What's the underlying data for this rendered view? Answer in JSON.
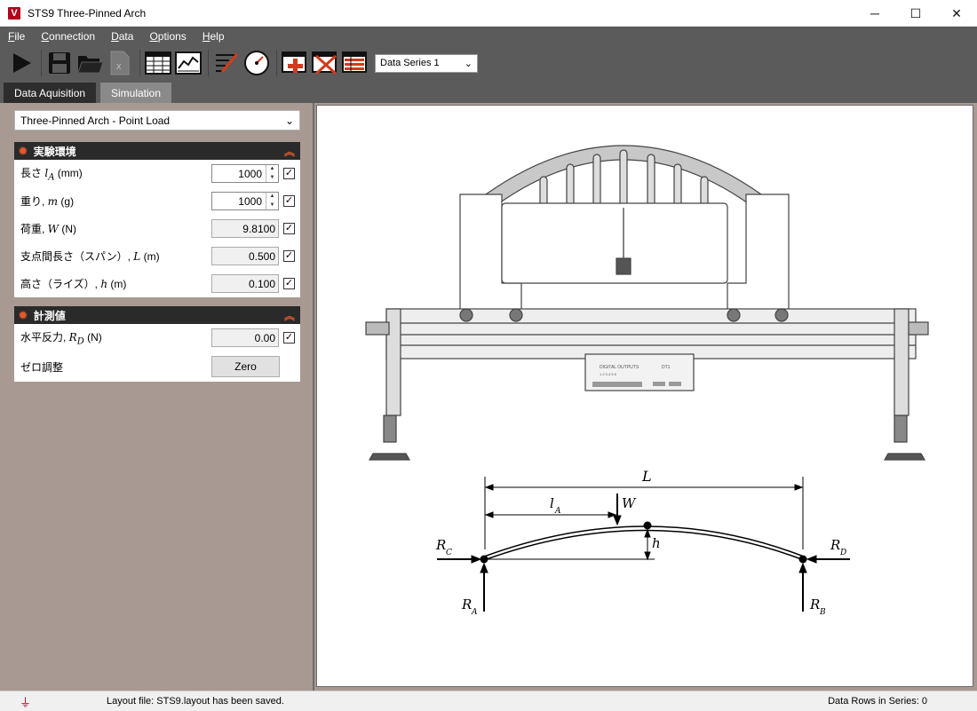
{
  "window": {
    "title": "STS9 Three-Pinned Arch",
    "minimize": "─",
    "maximize": "☐",
    "close": "✕"
  },
  "menu": {
    "file": {
      "u": "F",
      "rest": "ile"
    },
    "connection": {
      "u": "C",
      "rest": "onnection"
    },
    "data": {
      "u": "D",
      "rest": "ata"
    },
    "options": {
      "u": "O",
      "rest": "ptions"
    },
    "help": {
      "u": "H",
      "rest": "elp"
    }
  },
  "toolbar": {
    "series_select": "Data Series 1",
    "icons": [
      "play-icon",
      "save-icon",
      "open-folder-icon",
      "export-excel-icon",
      "table-view-icon",
      "chart-view-icon",
      "edit-sensor-icon",
      "gauge-icon",
      "add-row-icon",
      "delete-row-icon",
      "clear-table-icon"
    ]
  },
  "tabs": {
    "data_acquisition": "Data Aquisition",
    "simulation": "Simulation"
  },
  "mode_select": "Three-Pinned Arch - Point Load",
  "setup": {
    "title": "実験環境",
    "rows": [
      {
        "label": "長さ ",
        "sym": "l",
        "sub": "A",
        "unit": " (mm)",
        "value": "1000"
      },
      {
        "label": "重り, ",
        "sym": "m",
        "sub": "",
        "unit": " (g)",
        "value": "1000"
      },
      {
        "label": "荷重, ",
        "sym": "W",
        "sub": "",
        "unit": " (N)",
        "value": "9.8100"
      },
      {
        "label": "支点間長さ（スパン）, ",
        "sym": "L",
        "sub": "",
        "unit": " (m)",
        "value": "0.500"
      },
      {
        "label": "高さ（ライズ）, ",
        "sym": "h",
        "sub": "",
        "unit": " (m)",
        "value": "0.100"
      }
    ]
  },
  "measurement": {
    "title": "計測値",
    "reaction": {
      "label": "水平反力, ",
      "sym": "R",
      "sub": "D",
      "unit": " (N)",
      "value": "0.00"
    },
    "zero_label": "ゼロ調整",
    "zero_button": "Zero"
  },
  "diagram": {
    "device_text": "DIGITAL OUTPUTS",
    "device_channels": "1   2   3   4   5   6",
    "device_model": "DT1",
    "L": "L",
    "lA": "l",
    "lA_sub": "A",
    "W": "W",
    "h": "h",
    "RC": "R",
    "RC_sub": "C",
    "RD": "R",
    "RD_sub": "D",
    "RA": "R",
    "RA_sub": "A",
    "RB": "R",
    "RB_sub": "B"
  },
  "status": {
    "message": "Layout file: STS9.layout has been saved.",
    "rows": "Data Rows in Series: 0"
  },
  "colors": {
    "chrome": "#5b5b5b",
    "panel": "#a89993",
    "accent": "#e25b2a",
    "brand": "#b3001b"
  }
}
